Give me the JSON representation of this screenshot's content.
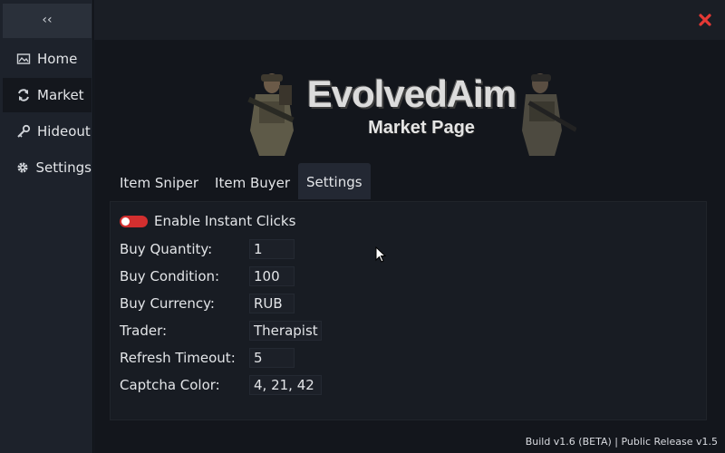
{
  "sidebar": {
    "collapse_label": "‹‹",
    "items": [
      {
        "label": "Home",
        "icon": "image-icon"
      },
      {
        "label": "Market",
        "icon": "refresh-icon"
      },
      {
        "label": "Hideout",
        "icon": "key-icon"
      },
      {
        "label": "Settings",
        "icon": "gear-icon"
      }
    ],
    "active": "Market"
  },
  "banner": {
    "title": "EvolvedAim",
    "subtitle": "Market Page"
  },
  "tabs": [
    {
      "label": "Item Sniper"
    },
    {
      "label": "Item Buyer"
    },
    {
      "label": "Settings"
    }
  ],
  "active_tab": "Settings",
  "settings": {
    "instant_clicks_label": "Enable Instant Clicks",
    "instant_clicks_enabled": false,
    "fields": [
      {
        "label": "Buy Quantity:",
        "value": "1"
      },
      {
        "label": "Buy Condition:",
        "value": "100"
      },
      {
        "label": "Buy Currency:",
        "value": "RUB"
      },
      {
        "label": "Trader:",
        "value": "Therapist"
      },
      {
        "label": "Refresh Timeout:",
        "value": "5"
      },
      {
        "label": "Captcha Color:",
        "value": "4, 21, 42"
      }
    ]
  },
  "footer": "Build v1.6 (BETA) | Public Release v1.5",
  "colors": {
    "toggle_off": "#d32f2f",
    "close": "#e53935",
    "background": "#13161c"
  }
}
